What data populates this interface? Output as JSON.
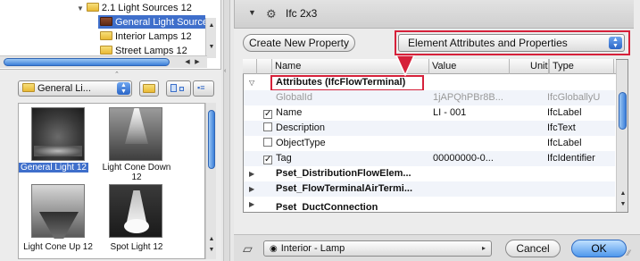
{
  "tree": {
    "items": [
      {
        "label": "2.1 Light Sources 12",
        "folder": "yellow",
        "expanded": true
      },
      {
        "label": "General Light Sources",
        "folder": "brown",
        "selected": true
      },
      {
        "label": "Interior Lamps 12",
        "folder": "yellow"
      },
      {
        "label": "Street Lamps 12",
        "folder": "yellow"
      }
    ]
  },
  "library": {
    "folder_select": "General Li...",
    "items": [
      {
        "label": "General Light 12",
        "selected": true
      },
      {
        "label": "Light Cone Down 12",
        "selected": false
      },
      {
        "label": "Light Cone Up 12",
        "selected": false
      },
      {
        "label": "Spot Light 12",
        "selected": false
      }
    ]
  },
  "header": {
    "title": "Ifc 2x3"
  },
  "toolbar": {
    "create_label": "Create New Property",
    "view_select": "Element Attributes and Properties"
  },
  "table": {
    "columns": [
      "Name",
      "Value",
      "Unit",
      "Type"
    ],
    "group": "Attributes (IfcFlowTerminal)",
    "rows": [
      {
        "name": "GlobalId",
        "value": "1jAPQhPBr8B...",
        "type": "IfcGloballyU",
        "checkbox": null,
        "gray": true
      },
      {
        "name": "Name",
        "value": "LI - 001",
        "type": "IfcLabel",
        "checkbox": true
      },
      {
        "name": "Description",
        "value": "",
        "type": "IfcText",
        "checkbox": false
      },
      {
        "name": "ObjectType",
        "value": "",
        "type": "IfcLabel",
        "checkbox": false
      },
      {
        "name": "Tag",
        "value": "00000000-0...",
        "type": "IfcIdentifier",
        "checkbox": true
      }
    ],
    "property_sets": [
      "Pset_DistributionFlowElem...",
      "Pset_FlowTerminalAirTermi...",
      "Pset_DuctConnection"
    ]
  },
  "footer": {
    "layer": "Interior - Lamp",
    "cancel_label": "Cancel",
    "ok_label": "OK"
  },
  "colors": {
    "highlight_red": "#d6213a",
    "selection_blue": "#3f6fcb",
    "aqua_blue": "#4f98ec"
  }
}
